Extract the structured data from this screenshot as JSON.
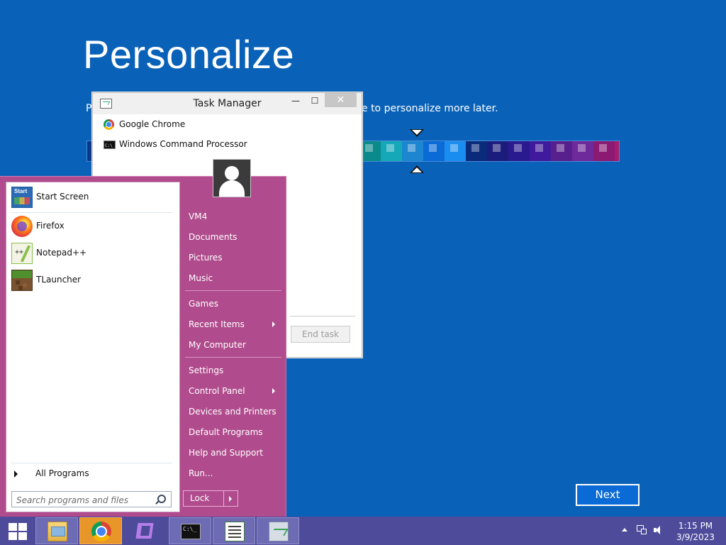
{
  "oobe": {
    "title": "Personalize",
    "subtitle_left": "P",
    "subtitle_right": "e to personalize more later.",
    "next_label": "Next",
    "palette_colors": [
      "#0a8a8a",
      "#14a8b8",
      "#1c86d0",
      "#0a6ad6",
      "#1a8ef0",
      "#0a2a7a",
      "#1c1c7c",
      "#2a1a90",
      "#401a9c",
      "#58208c",
      "#6e2a9a",
      "#8a1a72",
      "#a81a6e",
      "#c01a78",
      "#d81a96"
    ]
  },
  "task_manager": {
    "title": "Task Manager",
    "minimize": "—",
    "maximize": "☐",
    "close": "✕",
    "items": [
      {
        "label": "Google Chrome"
      },
      {
        "label": "Windows Command Processor"
      }
    ],
    "end_task_label": "End task"
  },
  "start_menu": {
    "pinned": [
      {
        "label": "Start Screen",
        "icon": "start-screen-icon"
      },
      {
        "label": "Firefox",
        "icon": "firefox-icon"
      },
      {
        "label": "Notepad++",
        "icon": "notepad-plus-plus-icon"
      },
      {
        "label": "TLauncher",
        "icon": "tlauncher-icon"
      }
    ],
    "all_programs": "All Programs",
    "search_placeholder": "Search programs and files",
    "right": {
      "vm4": "VM4",
      "documents": "Documents",
      "pictures": "Pictures",
      "music": "Music",
      "games": "Games",
      "recent_items": "Recent Items",
      "my_computer": "My Computer",
      "settings": "Settings",
      "control_panel": "Control Panel",
      "devices_printers": "Devices and Printers",
      "default_programs": "Default Programs",
      "help_support": "Help and Support",
      "run": "Run..."
    },
    "lock_label": "Lock"
  },
  "taskbar": {
    "clock_time": "1:15 PM",
    "clock_date": "3/9/2023"
  }
}
